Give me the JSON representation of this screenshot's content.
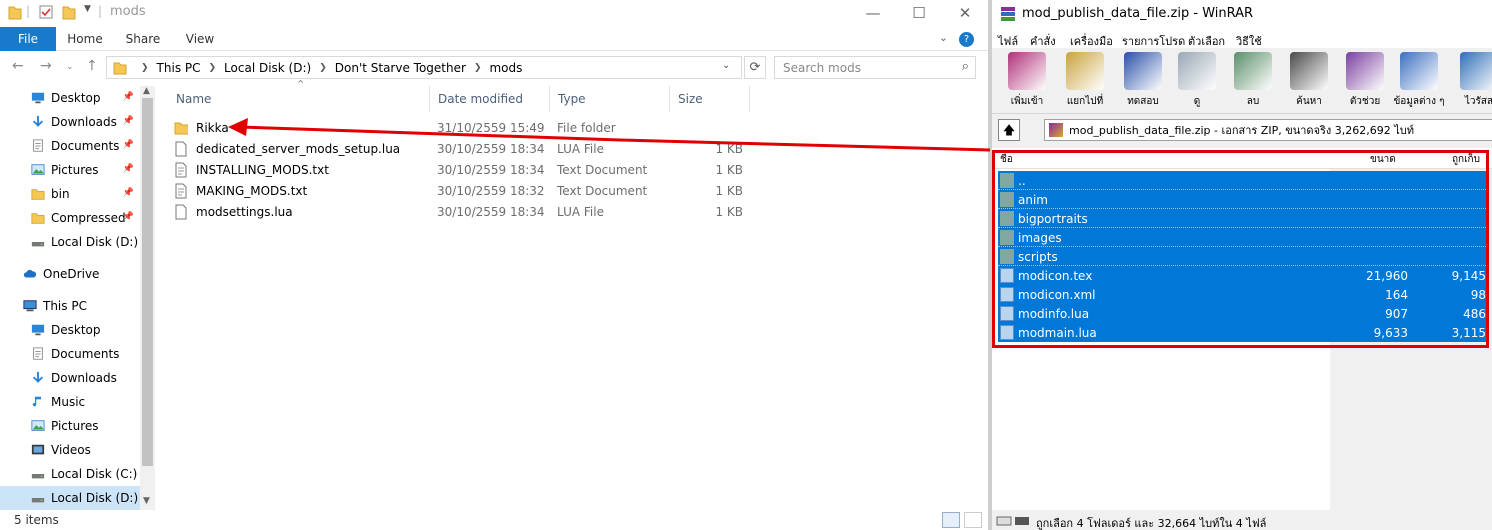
{
  "explorer": {
    "title": "mods",
    "ribbon_tabs": [
      "File",
      "Home",
      "Share",
      "View"
    ],
    "help": "?",
    "address": [
      "This PC",
      "Local Disk (D:)",
      "Don't Starve Together",
      "mods"
    ],
    "search_placeholder": "Search mods",
    "nav": [
      {
        "label": "Desktop",
        "icon": "desktop-icon",
        "pinned": true
      },
      {
        "label": "Downloads",
        "icon": "download-icon",
        "pinned": true
      },
      {
        "label": "Documents",
        "icon": "documents-icon",
        "pinned": true
      },
      {
        "label": "Pictures",
        "icon": "pictures-icon",
        "pinned": true
      },
      {
        "label": "bin",
        "icon": "folder-icon",
        "pinned": true
      },
      {
        "label": "Compressed",
        "icon": "folder-icon",
        "pinned": true
      },
      {
        "label": "Local Disk (D:)",
        "icon": "drive-icon",
        "pinned": false
      },
      {
        "label": "OneDrive",
        "icon": "cloud-icon",
        "pinned": false
      },
      {
        "label": "This PC",
        "icon": "computer-icon",
        "pinned": false
      },
      {
        "label": "Desktop",
        "icon": "desktop-icon",
        "pinned": false
      },
      {
        "label": "Documents",
        "icon": "documents-icon",
        "pinned": false
      },
      {
        "label": "Downloads",
        "icon": "download-icon",
        "pinned": false
      },
      {
        "label": "Music",
        "icon": "music-icon",
        "pinned": false
      },
      {
        "label": "Pictures",
        "icon": "pictures-icon",
        "pinned": false
      },
      {
        "label": "Videos",
        "icon": "videos-icon",
        "pinned": false
      },
      {
        "label": "Local Disk (C:)",
        "icon": "drive-icon",
        "pinned": false
      },
      {
        "label": "Local Disk (D:)",
        "icon": "drive-icon",
        "pinned": false
      }
    ],
    "columns": [
      "Name",
      "Date modified",
      "Type",
      "Size"
    ],
    "files": [
      {
        "name": "Rikka",
        "date": "31/10/2559 15:49",
        "type": "File folder",
        "size": "",
        "icon": "folder-icon"
      },
      {
        "name": "dedicated_server_mods_setup.lua",
        "date": "30/10/2559 18:34",
        "type": "LUA File",
        "size": "1 KB",
        "icon": "file-icon"
      },
      {
        "name": "INSTALLING_MODS.txt",
        "date": "30/10/2559 18:34",
        "type": "Text Document",
        "size": "1 KB",
        "icon": "text-file-icon"
      },
      {
        "name": "MAKING_MODS.txt",
        "date": "30/10/2559 18:32",
        "type": "Text Document",
        "size": "1 KB",
        "icon": "text-file-icon"
      },
      {
        "name": "modsettings.lua",
        "date": "30/10/2559 18:34",
        "type": "LUA File",
        "size": "1 KB",
        "icon": "file-icon"
      }
    ],
    "status": "5 items"
  },
  "winrar": {
    "title": "mod_publish_data_file.zip - WinRAR",
    "menu": [
      "ไฟล์",
      "คำสั่ง",
      "เครื่องมือ",
      "รายการโปรด",
      "ตัวเลือก",
      "วิธีใช้"
    ],
    "toolbar": [
      {
        "label": "เพิ่มเข้า",
        "color": "#b0307a"
      },
      {
        "label": "แยกไปที่",
        "color": "#c9a43a"
      },
      {
        "label": "ทดสอบ",
        "color": "#2a4fa8"
      },
      {
        "label": "ดู",
        "color": "#9aa7b5"
      },
      {
        "label": "ลบ",
        "color": "#5a8f6a"
      },
      {
        "label": "ค้นหา",
        "color": "#4a4a4a"
      },
      {
        "label": "ตัวช่วย",
        "color": "#7a3fa0"
      },
      {
        "label": "ข้อมูลต่าง ๆ",
        "color": "#3b6fc0"
      },
      {
        "label": "ไวรัสส",
        "color": "#2f6fb8"
      }
    ],
    "path": "mod_publish_data_file.zip - เอกสาร ZIP, ขนาดจริง 3,262,692 ไบท์",
    "columns": {
      "name": "ชื่อ",
      "size": "ขนาด",
      "packed": "ถูกเก็บ"
    },
    "rows": [
      {
        "name": "..",
        "size": "",
        "packed": "",
        "kind": "folder"
      },
      {
        "name": "anim",
        "size": "",
        "packed": "",
        "kind": "folder"
      },
      {
        "name": "bigportraits",
        "size": "",
        "packed": "",
        "kind": "folder"
      },
      {
        "name": "images",
        "size": "",
        "packed": "",
        "kind": "folder"
      },
      {
        "name": "scripts",
        "size": "",
        "packed": "",
        "kind": "folder"
      },
      {
        "name": "modicon.tex",
        "size": "21,960",
        "packed": "9,145",
        "kind": "file"
      },
      {
        "name": "modicon.xml",
        "size": "164",
        "packed": "98",
        "kind": "file"
      },
      {
        "name": "modinfo.lua",
        "size": "907",
        "packed": "486",
        "kind": "file"
      },
      {
        "name": "modmain.lua",
        "size": "9,633",
        "packed": "3,115",
        "kind": "file"
      }
    ],
    "status": "ถูกเลือก 4 โฟลเดอร์ และ 32,664 ไบท์ใน 4 ไฟล์"
  },
  "colors": {
    "selection": "#0078d7",
    "annotation": "#e00000",
    "ribbon_file": "#1979ca"
  }
}
